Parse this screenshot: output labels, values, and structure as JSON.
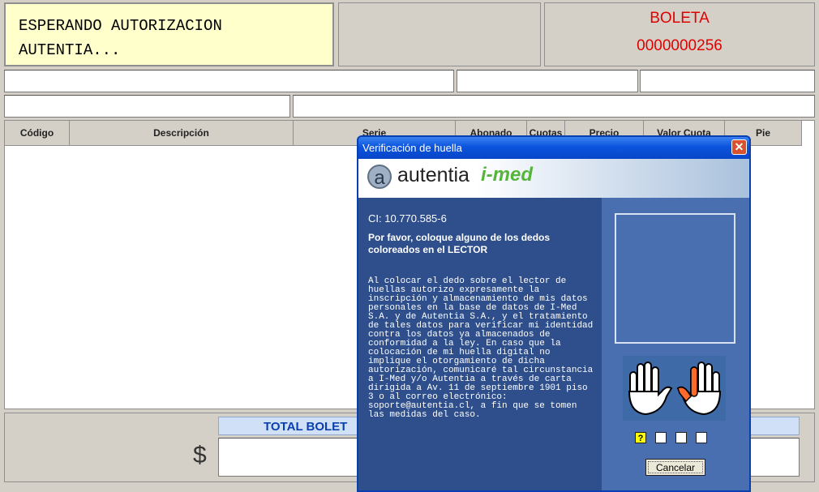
{
  "status": {
    "line1": "ESPERANDO AUTORIZACION",
    "line2": "AUTENTIA..."
  },
  "boleta": {
    "label": "BOLETA",
    "number": "0000000256"
  },
  "table": {
    "columns": [
      "Código",
      "Descripción",
      "Serie",
      "Abonado",
      "Cuotas",
      "Precio",
      "Valor Cuota",
      "Pie"
    ]
  },
  "footer": {
    "total_label": "TOTAL BOLET",
    "currency": "$"
  },
  "dialog": {
    "title": "Verificación de huella",
    "close": "✕",
    "logo_letter": "a",
    "brand1": "autentia",
    "brand2": "i-med",
    "ci": "CI: 10.770.585-6",
    "instruction": "Por favor, coloque alguno de los dedos coloreados en el LECTOR",
    "legal": "Al colocar el dedo sobre el lector de huellas autorizo expresamente la inscripción y almacenamiento de mis datos personales en la base de datos de I-Med S.A. y de Autentia S.A., y el tratamiento de tales datos para verificar mi identidad contra los datos ya almacenados de conformidad a la ley. En caso que la colocación de mi huella digital no implique el otorgamiento de dicha autorización, comunicaré tal circunstancia a I-Med y/o Autentia a través de carta dirigida a Av. 11 de septiembre 1901 piso 3 o al correo electrónico: soporte@autentia.cl, a fin que se tomen las medidas del caso.",
    "help": "?",
    "cancel": "Cancelar",
    "colors": {
      "highlight_finger": "#ff6a2a",
      "help_bg": "#ffff00"
    }
  }
}
